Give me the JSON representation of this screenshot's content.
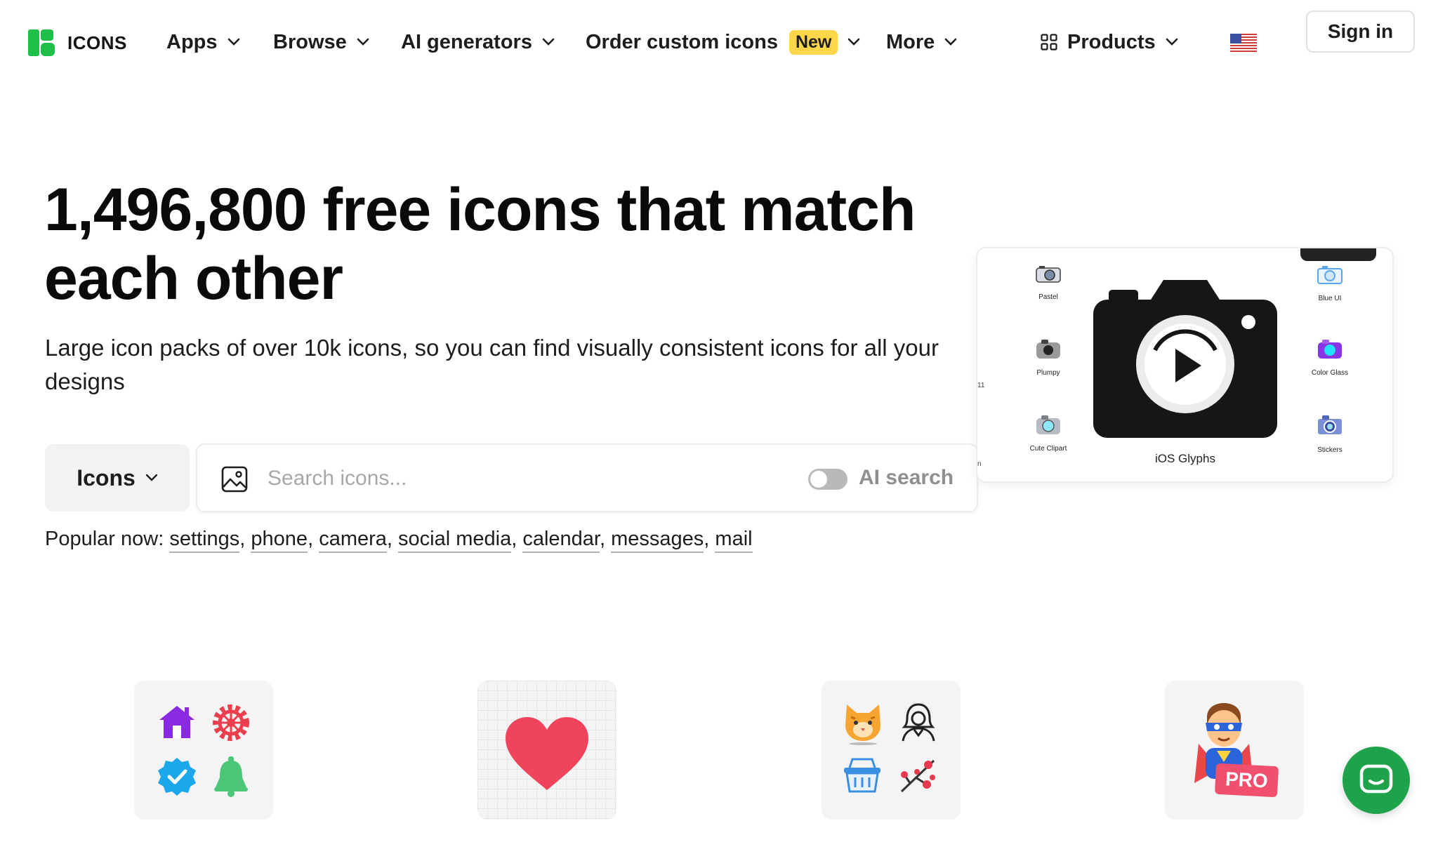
{
  "brand": {
    "name": "ICONS",
    "color": "#1fbf4a"
  },
  "nav": {
    "apps": "Apps",
    "browse": "Browse",
    "ai_generators": "AI generators",
    "order_custom": "Order custom icons",
    "new_badge": "New",
    "more": "More",
    "products": "Products",
    "sign_in": "Sign in",
    "language_flag": "us-flag-icon"
  },
  "hero": {
    "title": "1,496,800 free icons that match each other",
    "subtitle": "Large icon packs of over 10k icons, so you can find visually consistent icons for all your designs"
  },
  "search": {
    "type_selected": "Icons",
    "placeholder": "Search icons...",
    "value": "",
    "ai_search_label": "AI search",
    "ai_search_enabled": false
  },
  "popular": {
    "label": "Popular now:",
    "items": [
      "settings",
      "phone",
      "camera",
      "social media",
      "calendar",
      "messages",
      "mail"
    ]
  },
  "showcase": {
    "center_style": "iOS Glyphs",
    "styles": [
      "Pastel",
      "Plumpy",
      "Cute Clipart",
      "Blue UI",
      "Color Glass",
      "Stickers"
    ],
    "edge_left_fragments": [
      "11",
      "n"
    ]
  },
  "tiles": {
    "pro_badge": "PRO",
    "icons": [
      "house-icon",
      "gear-icon",
      "verified-badge-icon",
      "bell-icon",
      "heart-icon",
      "cat-icon",
      "woman-icon",
      "basket-icon",
      "blossom-icon",
      "superhero-icon"
    ]
  },
  "colors": {
    "accent_green": "#1fbf4a",
    "new_badge": "#ffd54a",
    "pro_badge": "#f0506e",
    "chat_button": "#1fa34a",
    "heart": "#f0435c"
  }
}
